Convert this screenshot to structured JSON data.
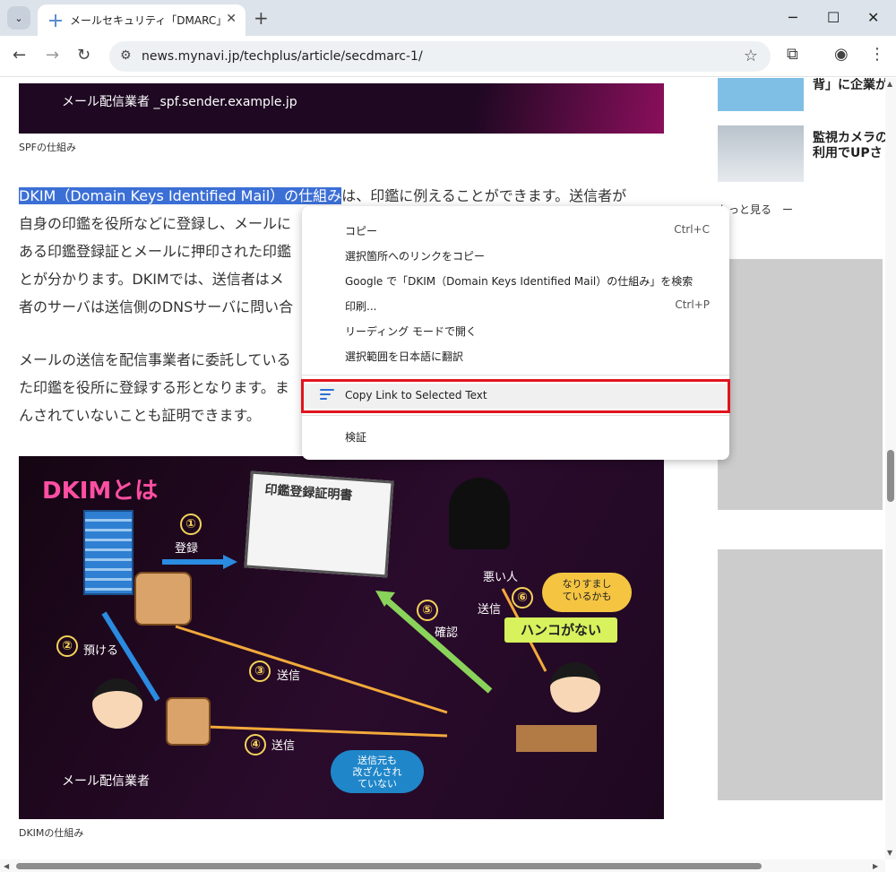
{
  "tab": {
    "title": "メールセキュリティ「DMARC」運用時",
    "close": "✕"
  },
  "window": {
    "minimize": "─",
    "maximize": "☐",
    "close": "✕",
    "new_tab": "+"
  },
  "toolbar": {
    "back": "←",
    "forward": "→",
    "reload": "↻",
    "url": "news.mynavi.jp/techplus/article/secdmarc-1/",
    "tune": "⚙",
    "star": "☆",
    "extensions": "⧉",
    "profile": "◉",
    "menu": "⋮"
  },
  "article": {
    "banner_text": "メール配信業者 _spf.sender.example.jp",
    "caption_spf": "SPFの仕組み",
    "para1_highlight": "DKIM（Domain Keys Identified Mail）の仕組み",
    "para1_rest": "は、印鑑に例えることができます。送信者が",
    "para1_lines": [
      "自身の印鑑を役所などに登録し、メールに",
      "ある印鑑登録証とメールに押印された印鑑",
      "とが分かります。DKIMでは、送信者はメ",
      "者のサーバは送信側のDNSサーバに問い合"
    ],
    "para2_lines": [
      "メールの送信を配信事業者に委託している",
      "た印鑑を役所に登録する形となります。ま",
      "んされていないことも証明できます。"
    ],
    "caption_dkim": "DKIMの仕組み"
  },
  "diagram": {
    "title": "DKIMとは",
    "cert_title": "印鑑登録証明書",
    "step1": "①",
    "step1_label": "登録",
    "step2": "②",
    "step2_label": "預ける",
    "step3": "③",
    "step3_label": "送信",
    "step4": "④",
    "step4_label": "送信",
    "step5": "⑤",
    "step5_label": "確認",
    "step6": "⑥",
    "step6_label": "送信",
    "bad_person": "悪い人",
    "bubble_spoof": "なりすまし\nているかも",
    "no_hanko": "ハンコがない",
    "bubble_ok": "送信元も\n改ざんされ\nていない",
    "sender": "メール配信業者"
  },
  "sidebar": {
    "item1_text": "背」に企業が",
    "item2_text_line1": "監視カメラの",
    "item2_text_line2": "利用でUPさ",
    "more": "もっと見る　ー"
  },
  "context_menu": {
    "items": [
      {
        "label": "コピー",
        "shortcut": "Ctrl+C"
      },
      {
        "label": "選択箇所へのリンクをコピー",
        "shortcut": ""
      },
      {
        "label": "Google で「DKIM（Domain Keys Identified Mail）の仕組み」を検索",
        "shortcut": ""
      },
      {
        "label": "印刷...",
        "shortcut": "Ctrl+P"
      },
      {
        "label": "リーディング モードで開く",
        "shortcut": ""
      },
      {
        "label": "選択範囲を日本語に翻訳",
        "shortcut": ""
      },
      {
        "label": "Copy Link to Selected Text",
        "shortcut": ""
      },
      {
        "label": "検証",
        "shortcut": ""
      }
    ]
  },
  "colors": {
    "highlight": "#3b6fd6",
    "annotation_box": "#e0141e",
    "accent_pink": "#ff4fa3"
  }
}
